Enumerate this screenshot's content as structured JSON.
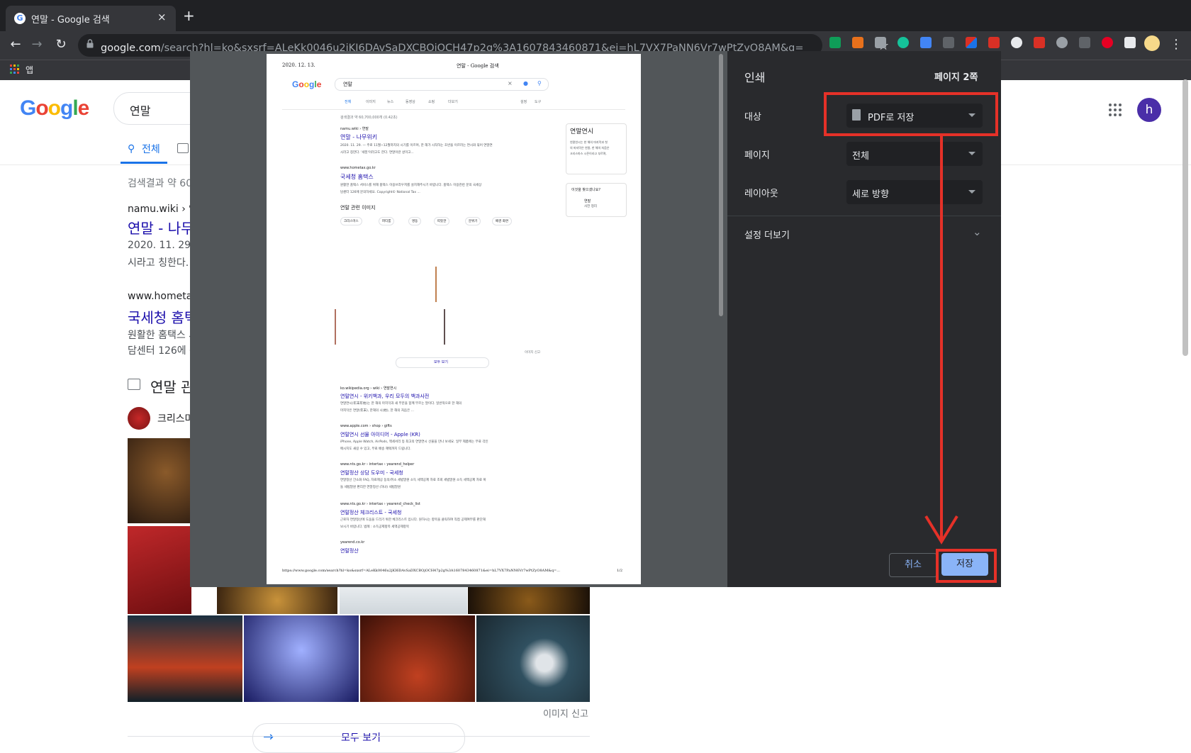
{
  "browser": {
    "tab_title": "연말 - Google 검색",
    "tab_favicon": "G",
    "tab_close": "×",
    "new_tab": "+",
    "url_host": "google.com",
    "url_rest": "/search?hl=ko&sxsrf=ALeKk0046u2jKI6DAvSaDXCBOjOCH47p2g%3A1607843460871&ei=hL7VX7PaNN6Vr7wPtZyO8AM&q=연말&oq...",
    "back_icon": "←",
    "forward_icon": "→",
    "reload_icon": "↻",
    "lock_icon": "🔒",
    "star_icon": "☆",
    "menu_icon": "⋮",
    "bookmark_apps_label": "앱",
    "extension_icons": [
      "sheets-icon",
      "ex-icon",
      "text-icon",
      "grammarly-icon",
      "translate-icon",
      "code-icon",
      "pen-icon",
      "chrome-cleaner-icon",
      "acrobat-icon",
      "refresh-ext-icon",
      "tb-icon",
      "cloud-icon",
      "notion-icon",
      "pinterest-icon",
      "puzzle-icon"
    ]
  },
  "search_page": {
    "logo": "Google",
    "query": "연말",
    "tab_all": "전체",
    "result_stats": "검색결과 약 60,7",
    "results": [
      {
        "cite": "namu.wiki › 연말",
        "title": "연말 - 나무",
        "snippet1": "2020. 11. 29. —",
        "snippet2": "시라고 칭한다. '"
      },
      {
        "cite": "www.hometax.",
        "title": "국세청 홈택",
        "snippet1": "원활한 홈택스 서",
        "snippet2": "담센터 126에 문"
      }
    ],
    "images_section_title": "연말 관",
    "image_chip": "크리스마",
    "image_report": "이미지 신고",
    "see_all": "모두 보기",
    "user_initial": "h"
  },
  "print_preview": {
    "header_date": "2020. 12. 13.",
    "header_title": "연말 - Google 검색",
    "query": "연말",
    "tabs": [
      "전체",
      "이미지",
      "뉴스",
      "동영상",
      "쇼핑",
      "더보기"
    ],
    "tools": [
      "설정",
      "도구"
    ],
    "stats": "검색결과 약 60,700,000개 (0.42초)",
    "kp_title": "연말연시",
    "kp_text1": "연말연시는 한 해의 마지막과 첫",
    "kp_text2": "의 마지막은 연말, 한 해의 처음은",
    "kp_text3": "크리스마스 시즌이라고 부르며,",
    "kp_also": "이것을 찾으셨나요?",
    "kp_also_item1": "연말",
    "kp_also_item2": "사전 정리",
    "results": [
      {
        "cite": "namu.wiki › 연말",
        "title": "연말 - 나무위키",
        "s1": "2020. 11. 29. — 주로 11월~12월까지의 시기를 이르며, 한 해가 시작하는 초반을 이르러는 연시와 묶어 연말연",
        "s2": "시라고 칭한다. '세밑'이라고도 한다. 연말이란 섣미고..."
      },
      {
        "cite": "www.hometax.go.kr",
        "title": "국세청 홈택스",
        "s1": "원활한 홈택스 서비스를 위해 홈택스 이용브라우저를 설치해주시기 바랍니다. 홈택스 이용관련 문의 국세상",
        "s2": "담센터 126에 문의하세요. Copyright© National Tax ..."
      }
    ],
    "images_title": "연말 관련 이미지",
    "chips": [
      "크리스마스",
      "파티룸",
      "명동",
      "따뜻한",
      "분위기",
      "배경 화면"
    ],
    "images_report": "이미지 신고",
    "see_all": "모두 보기",
    "results2": [
      {
        "cite": "ko.wikipedia.org › wiki › 연말연시",
        "title": "연말연시 - 위키백과, 우리 모두의 백과사전",
        "s1": "연말연시(年末年始)는 한 해의 마지막과 새 부분을 함께 부르는 말이다. 일반적으로 한 해의",
        "s2": "마지막은 연말(年末), 한해의 시(始), 한 해의 처음은 ..."
      },
      {
        "cite": "www.apple.com › shop › gifts",
        "title": "연말연시 선물 아이디어 - Apple (KR)",
        "s1": "iPhone, Apple Watch, AirPods, 액세서리 등 최고의 연말연시 선물을 만나 보세요. 일부 제품에는 무료 각인",
        "s2": "메시지도 새길 수 있고, 무료 배송 혜택까지 드립니다."
      },
      {
        "cite": "www.nts.go.kr › intertax › yearend_helper",
        "title": "연말정산 상담 도우미 - 국세청",
        "s1": "연말정산 간소화 FAQ, 자료제공 동의/취소 세법말원 소득 세액공제 자료 조회 세법말원 소득 세액공제 자료 복",
        "s2": "들 세법말원 편리한 연말정산 (하녀) 세법말원"
      },
      {
        "cite": "www.nts.go.kr › intertax › yearend_check_list",
        "title": "연말정산 체크리스트 - 국세청",
        "s1": "근로자 연말정산에 도움을 드리기 위한 체크리스트 입니다. 원하시는 항목을 클릭하여 직접 공제여부를 판단해",
        "s2": "보시기 바랍니다. 범례 : 소득공제항목 세액공제항목"
      },
      {
        "cite": "yearend.co.kr",
        "title": "연말정산",
        "s1": "",
        "s2": ""
      }
    ],
    "footer_url": "https://www.google.com/search?hl=ko&sxsrf=ALeKk0046u2jKI6DAvSaDXCBOjOCH47p2g%3A1607843460871&ei=hL7VX7PaNN6Vr7wPtZyO8AM&q=...",
    "footer_page": "1/2"
  },
  "print_settings": {
    "title": "인쇄",
    "page_count": "페이지 2쪽",
    "destination_label": "대상",
    "destination_value": "PDF로 저장",
    "pages_label": "페이지",
    "pages_value": "전체",
    "layout_label": "레이아웃",
    "layout_value": "세로 방향",
    "more_settings": "설정 더보기",
    "cancel": "취소",
    "save": "저장"
  },
  "annotation_color": "#e53128"
}
